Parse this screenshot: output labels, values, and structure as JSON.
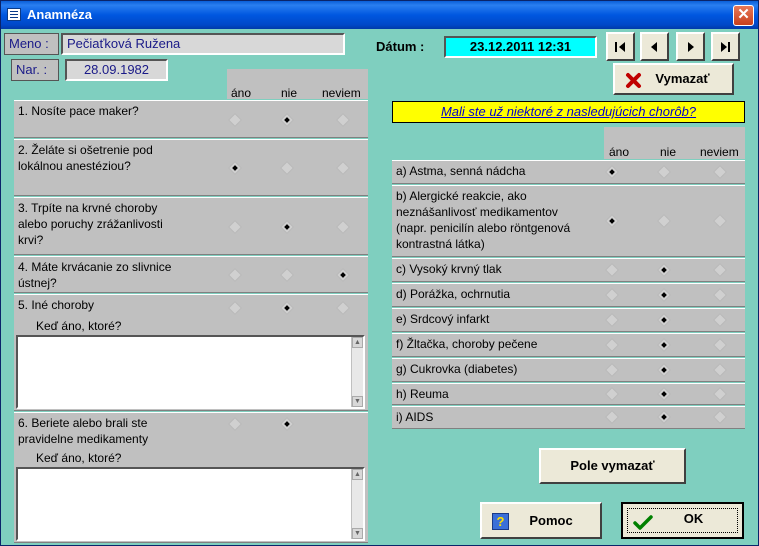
{
  "window": {
    "title": "Anamnéza",
    "close_label": "✕"
  },
  "patient": {
    "name_label": "Meno :",
    "name_value": "Pečiaťková Ružena",
    "birth_label": "Nar. :",
    "birth_value": "28.09.1982"
  },
  "date": {
    "label": "Dátum :",
    "value": "23.12.2011 12:31"
  },
  "columns": {
    "yes": "áno",
    "no": "nie",
    "unknown": "neviem"
  },
  "left_questions": [
    {
      "text": "1. Nosíte pace maker?",
      "answer": "nie"
    },
    {
      "text": "2. Želáte si ošetrenie pod lokálnou anestéziou?",
      "answer": "ano"
    },
    {
      "text": "3. Trpíte na krvné choroby alebo poruchy zrážanlivosti krvi?",
      "answer": "nie"
    },
    {
      "text": "4. Máte krvácanie zo slivnice ústnej?",
      "answer": "neviem"
    },
    {
      "text": "5. Iné choroby",
      "answer": "nie",
      "sub_label": "Keď áno, ktoré?"
    },
    {
      "text": "6. Beriete alebo brali ste pravidelne medikamenty",
      "answer": "nie",
      "sub_label": "Keď áno, ktoré?"
    }
  ],
  "right_header": "Mali ste už niektoré z nasledujúcich chorôb?",
  "diseases": [
    {
      "text": "a) Astma, senná nádcha",
      "answer": "ano"
    },
    {
      "text": "b) Alergické reakcie, ako neznášanlivosť medikamentov (napr. penicilín alebo röntgenová kontrastná látka)",
      "answer": "ano"
    },
    {
      "text": "c) Vysoký krvný tlak",
      "answer": "nie"
    },
    {
      "text": "d) Porážka, ochrnutia",
      "answer": "nie"
    },
    {
      "text": "e) Srdcový infarkt",
      "answer": "nie"
    },
    {
      "text": "f) Žltačka, choroby pečene",
      "answer": "nie"
    },
    {
      "text": "g) Cukrovka (diabetes)",
      "answer": "nie"
    },
    {
      "text": "h) Reuma",
      "answer": "nie"
    },
    {
      "text": "i) AIDS",
      "answer": "nie"
    }
  ],
  "buttons": {
    "delete": "Vymazať",
    "clear_fields": "Pole vymazať",
    "help": "Pomoc",
    "ok": "OK"
  },
  "icons": {
    "delete": "red-x-icon",
    "help": "question-mark-icon",
    "ok": "green-check-icon"
  },
  "colors": {
    "background": "#7fcfbf",
    "date_box": "#00ffff",
    "banner": "#ffff00",
    "title_bar": "#0057e0"
  }
}
